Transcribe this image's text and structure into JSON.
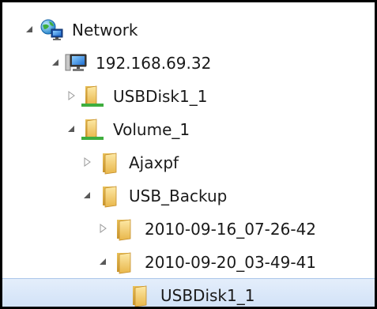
{
  "tree": {
    "items": [
      {
        "label": "Network",
        "icon": "network-globe-icon",
        "expander": "expanded"
      },
      {
        "label": "192.168.69.32",
        "icon": "computer-icon",
        "expander": "expanded"
      },
      {
        "label": "USBDisk1_1",
        "icon": "shared-folder-icon",
        "expander": "collapsed"
      },
      {
        "label": "Volume_1",
        "icon": "shared-folder-icon",
        "expander": "expanded"
      },
      {
        "label": "Ajaxpf",
        "icon": "folder-icon",
        "expander": "collapsed"
      },
      {
        "label": "USB_Backup",
        "icon": "folder-icon",
        "expander": "expanded"
      },
      {
        "label": "2010-09-16_07-26-42",
        "icon": "folder-icon",
        "expander": "collapsed"
      },
      {
        "label": "2010-09-20_03-49-41",
        "icon": "folder-icon",
        "expander": "expanded"
      },
      {
        "label": "USBDisk1_1",
        "icon": "folder-icon",
        "expander": "none",
        "selected": true
      }
    ]
  },
  "colors": {
    "selection_background": "#cfe0f6",
    "selection_border": "#aac6ea",
    "folder_yellow": "#f2c94c",
    "text": "#1a1a1a"
  }
}
